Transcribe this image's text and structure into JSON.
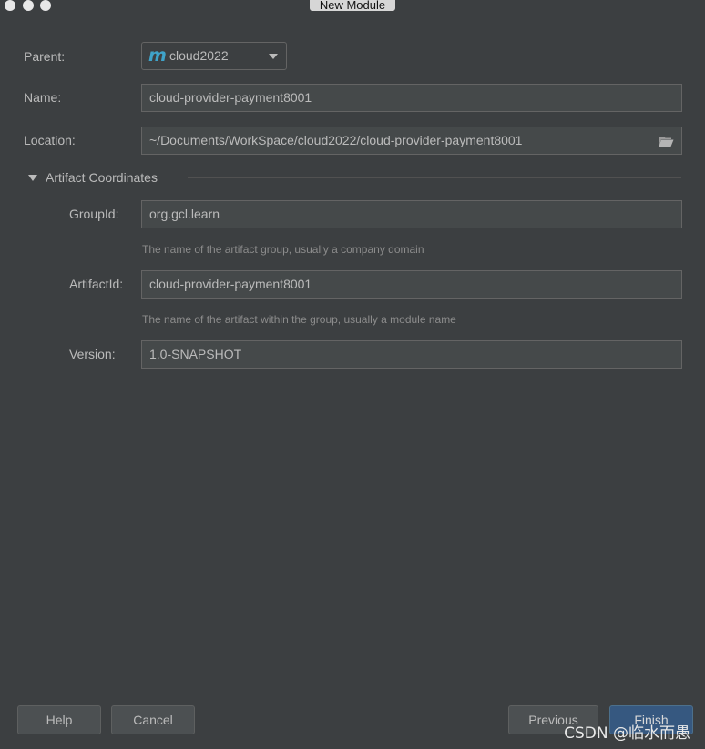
{
  "window": {
    "title": "New Module"
  },
  "form": {
    "parent_label": "Parent:",
    "parent_value": "cloud2022",
    "name_label": "Name:",
    "name_value": "cloud-provider-payment8001",
    "location_label": "Location:",
    "location_value": "~/Documents/WorkSpace/cloud2022/cloud-provider-payment8001"
  },
  "artifact": {
    "section_title": "Artifact Coordinates",
    "group_label": "GroupId:",
    "group_value": "org.gcl.learn",
    "group_hint": "The name of the artifact group, usually a company domain",
    "artifact_label": "ArtifactId:",
    "artifact_value": "cloud-provider-payment8001",
    "artifact_hint": "The name of the artifact within the group, usually a module name",
    "version_label": "Version:",
    "version_value": "1.0-SNAPSHOT"
  },
  "buttons": {
    "help": "Help",
    "cancel": "Cancel",
    "previous": "Previous",
    "finish": "Finish"
  },
  "watermark": "CSDN @临水而愚",
  "icons": {
    "parent": "maven-module-icon",
    "location": "folder-open-icon",
    "section": "triangle-down-icon",
    "dropdown": "chevron-down-icon"
  },
  "colors": {
    "background": "#3c3f41",
    "field": "#45494a",
    "accent": "#365880",
    "maven_icon": "#3fa3c9"
  }
}
